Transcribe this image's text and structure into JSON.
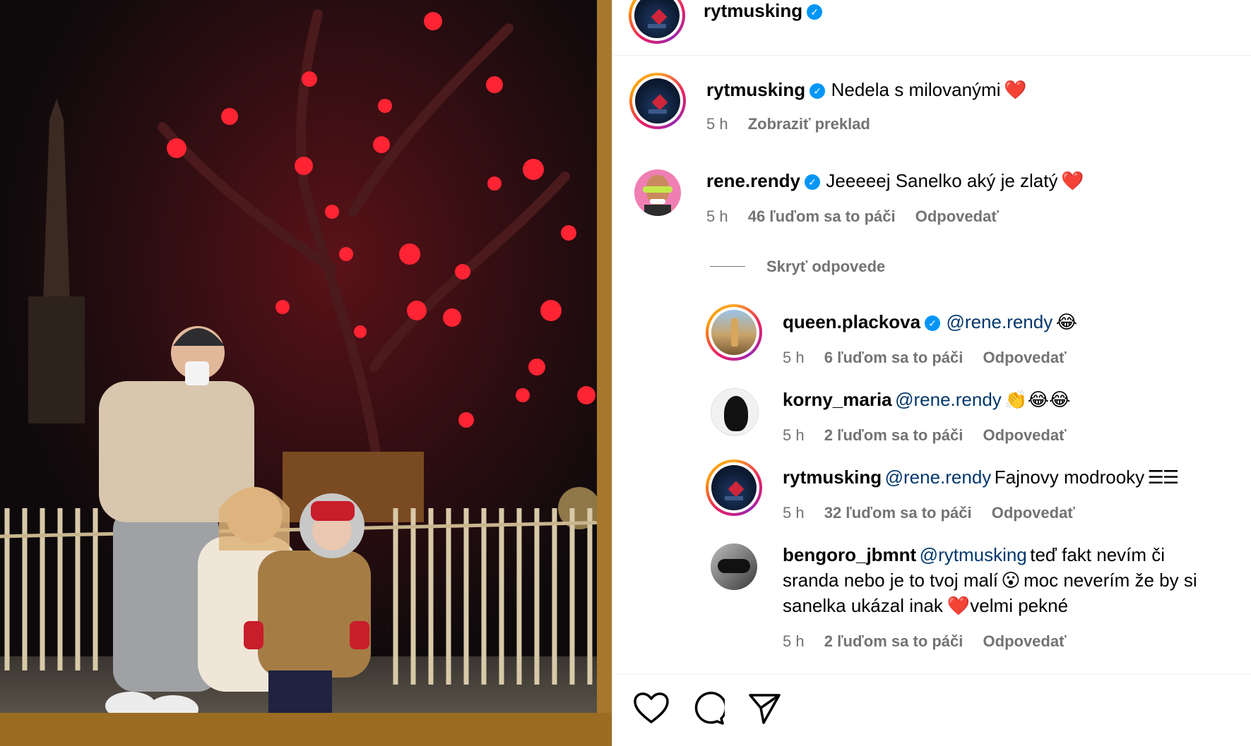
{
  "header": {
    "username": "rytmusking",
    "verified": true
  },
  "caption": {
    "username": "rytmusking",
    "text": "Nedela s milovanými",
    "emoji": "❤️",
    "time": "5 h",
    "translate_label": "Zobraziť preklad"
  },
  "comments": [
    {
      "username": "rene.rendy",
      "verified": true,
      "text": "Jeeeeej Sanelko aký je zlatý",
      "emoji": "❤️",
      "time": "5 h",
      "likes": "46 ľuďom sa to páči",
      "reply_label": "Odpovedať",
      "toggle_replies_label": "Skryť odpovede",
      "replies": [
        {
          "username": "queen.plackova",
          "verified": true,
          "mention": "@rene.rendy",
          "text": "",
          "emoji": "😂",
          "time": "5 h",
          "likes": "6 ľuďom sa to páči",
          "reply_label": "Odpovedať"
        },
        {
          "username": "korny_maria",
          "verified": false,
          "mention": "@rene.rendy",
          "text": "",
          "emoji": "👏😂😂",
          "time": "5 h",
          "likes": "2 ľuďom sa to páči",
          "reply_label": "Odpovedať"
        },
        {
          "username": "rytmusking",
          "verified": false,
          "mention": "@rene.rendy",
          "text": "Fajnovy modrooky",
          "emoji": "☰☰",
          "time": "5 h",
          "likes": "32 ľuďom sa to páči",
          "reply_label": "Odpovedať"
        },
        {
          "username": "bengoro_jbmnt",
          "verified": false,
          "mention": "@rytmusking",
          "text_line1": "teď fakt nevím či",
          "text_line2": "sranda nebo je to tvoj malí",
          "emoji_mid": "😮",
          "text_line2b": "moc neverím že by si",
          "text_line3a": "sanelka ukázal inak",
          "emoji_end": "❤️",
          "text_line3b": "velmi pekné",
          "time": "5 h",
          "likes": "2 ľuďom sa to páči",
          "reply_label": "Odpovedať"
        }
      ]
    }
  ],
  "actions": {
    "like_icon": "heart-outline-icon",
    "comment_icon": "comment-bubble-icon",
    "share_icon": "paper-plane-icon"
  },
  "colors": {
    "accent_link": "#00376b",
    "verified_blue": "#0095f6",
    "meta_gray": "#737373",
    "heart_red": "#e0243b"
  }
}
